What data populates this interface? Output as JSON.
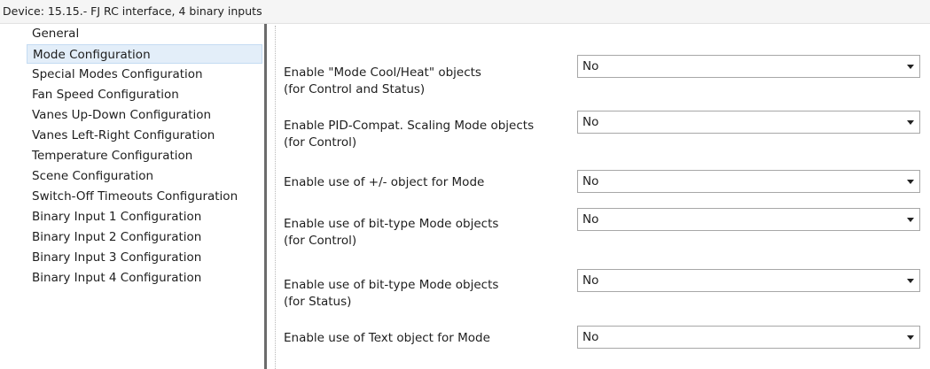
{
  "window": {
    "title": "Device: 15.15.-  FJ RC interface, 4 binary inputs"
  },
  "nav": {
    "items": [
      {
        "label": "General",
        "selected": false
      },
      {
        "label": "Mode Configuration",
        "selected": true
      },
      {
        "label": "Special Modes Configuration",
        "selected": false
      },
      {
        "label": "Fan Speed Configuration",
        "selected": false
      },
      {
        "label": "Vanes Up-Down Configuration",
        "selected": false
      },
      {
        "label": "Vanes Left-Right Configuration",
        "selected": false
      },
      {
        "label": "Temperature Configuration",
        "selected": false
      },
      {
        "label": "Scene Configuration",
        "selected": false
      },
      {
        "label": "Switch-Off Timeouts Configuration",
        "selected": false
      },
      {
        "label": "Binary Input 1 Configuration",
        "selected": false
      },
      {
        "label": "Binary Input 2 Configuration",
        "selected": false
      },
      {
        "label": "Binary Input 3 Configuration",
        "selected": false
      },
      {
        "label": "Binary Input 4 Configuration",
        "selected": false
      }
    ]
  },
  "params": [
    {
      "line1": "Enable \"Mode Cool/Heat\" objects",
      "line2": "(for Control and Status)",
      "value": "No"
    },
    {
      "line1": "Enable PID-Compat. Scaling Mode objects",
      "line2": "(for Control)",
      "value": "No"
    },
    {
      "line1": "Enable use of +/- object for Mode",
      "line2": "",
      "value": "No"
    },
    {
      "line1": "Enable use of bit-type Mode objects",
      "line2": "(for Control)",
      "value": "No"
    },
    {
      "line1": "Enable use of bit-type Mode objects",
      "line2": "(for Status)",
      "value": "No"
    },
    {
      "line1": "Enable use of Text object for Mode",
      "line2": "",
      "value": "No"
    }
  ]
}
